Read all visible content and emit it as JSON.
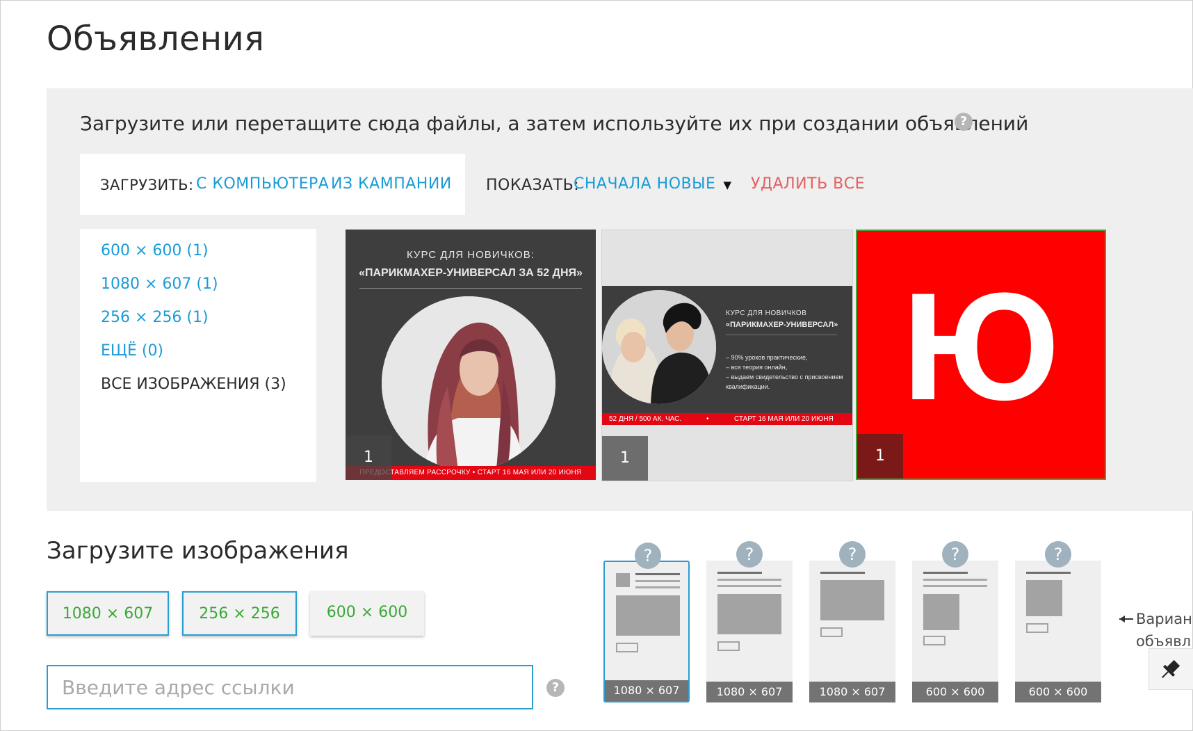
{
  "page": {
    "title": "Объявления"
  },
  "upload_panel": {
    "hint": "Загрузите или перетащите сюда файлы, а затем используйте их при создании объявлений",
    "upload_label": "ЗАГРУЗИТЬ:",
    "from_computer": "С КОМПЬЮТЕРА",
    "from_campaign": "ИЗ КАМПАНИИ",
    "show_label": "ПОКАЗАТЬ:",
    "sort_value": "СНАЧАЛА НОВЫЕ",
    "delete_all": "УДАЛИТЬ ВСЕ",
    "filters": [
      {
        "label": "600 × 600 (1)"
      },
      {
        "label": "1080 × 607 (1)"
      },
      {
        "label": "256 × 256 (1)"
      },
      {
        "label": "ЕЩЁ (0)"
      },
      {
        "label": "ВСЕ ИЗОБРАЖЕНИЯ (3)"
      }
    ],
    "thumbs": [
      {
        "count": "1",
        "line1": "КУРС ДЛЯ НОВИЧКОВ:",
        "line2": "«ПАРИКМАХЕР-УНИВЕРСАЛ ЗА 52 ДНЯ»",
        "strip": "ПРЕДОСТАВЛЯЕМ РАССРОЧКУ   •   СТАРТ 16 МАЯ ИЛИ 20 ИЮНЯ"
      },
      {
        "count": "1",
        "line1": "КУРС ДЛЯ НОВИЧКОВ",
        "line2": "«ПАРИКМАХЕР-УНИВЕРСАЛ»",
        "bullet1": "– 90% уроков практические,",
        "bullet2": "– вся теория онлайн,",
        "bullet3": "– выдаем свидетельство с присвоением",
        "bullet4": "квалификации.",
        "strip_left": "52 ДНЯ / 500 АК. ЧАС.",
        "strip_right": "СТАРТ 16 МАЯ ИЛИ 20 ИЮНЯ"
      },
      {
        "count": "1",
        "letter": "Ю"
      }
    ]
  },
  "upload_images": {
    "title": "Загрузите изображения",
    "sizes": [
      {
        "label": "1080 × 607"
      },
      {
        "label": "256 × 256"
      },
      {
        "label": "600 × 600"
      }
    ],
    "link_placeholder": "Введите адрес ссылки"
  },
  "variants": {
    "items": [
      {
        "label": "1080 × 607"
      },
      {
        "label": "1080 × 607"
      },
      {
        "label": "1080 × 607"
      },
      {
        "label": "600 × 600"
      },
      {
        "label": "600 × 600"
      }
    ],
    "help_mark": "?",
    "note_line1": "Вариан",
    "note_line2": "объявл"
  },
  "colors": {
    "accent_blue": "#1a9bd7",
    "danger_red": "#e45f5f",
    "size_green": "#3aa836",
    "panel_gray": "#efefef"
  }
}
